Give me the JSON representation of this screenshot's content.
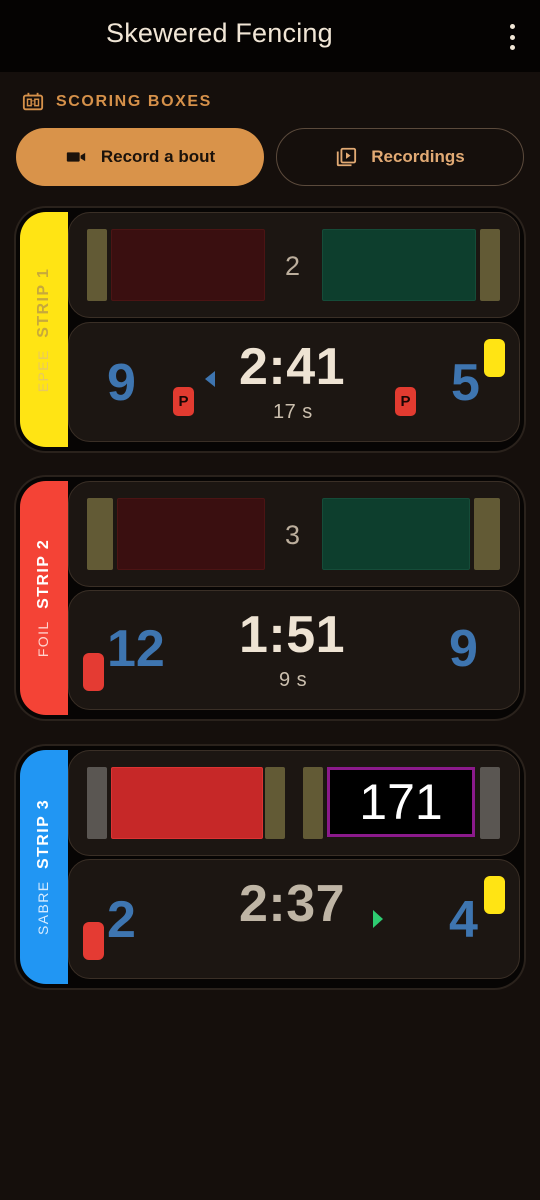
{
  "app": {
    "title": "Skewered Fencing"
  },
  "section": {
    "label": "SCORING BOXES"
  },
  "buttons": {
    "record": "Record a bout",
    "recordings": "Recordings"
  },
  "colors": {
    "accent": "#d9934a",
    "epee": "#ffe414",
    "foil": "#f44336",
    "sabre": "#2196f3",
    "score_blue": "#3e75b0"
  },
  "strips": [
    {
      "strip": "STRIP 1",
      "weapon": "EPEE",
      "light_counter": "2",
      "left_score": "9",
      "right_score": "5",
      "clock": "2:41",
      "seconds": "17 s",
      "left_penalty": "P",
      "right_penalty": "P",
      "priority": "left",
      "left_card": "none",
      "right_card": "yellow"
    },
    {
      "strip": "STRIP 2",
      "weapon": "FOIL",
      "light_counter": "3",
      "left_score": "12",
      "right_score": "9",
      "clock": "1:51",
      "seconds": "9 s",
      "left_card": "red",
      "right_card": "none"
    },
    {
      "strip": "STRIP 3",
      "weapon": "SABRE",
      "light_counter": "171",
      "left_score": "2",
      "right_score": "4",
      "clock": "2:37",
      "priority": "right",
      "left_card": "red",
      "right_card": "yellow"
    }
  ]
}
